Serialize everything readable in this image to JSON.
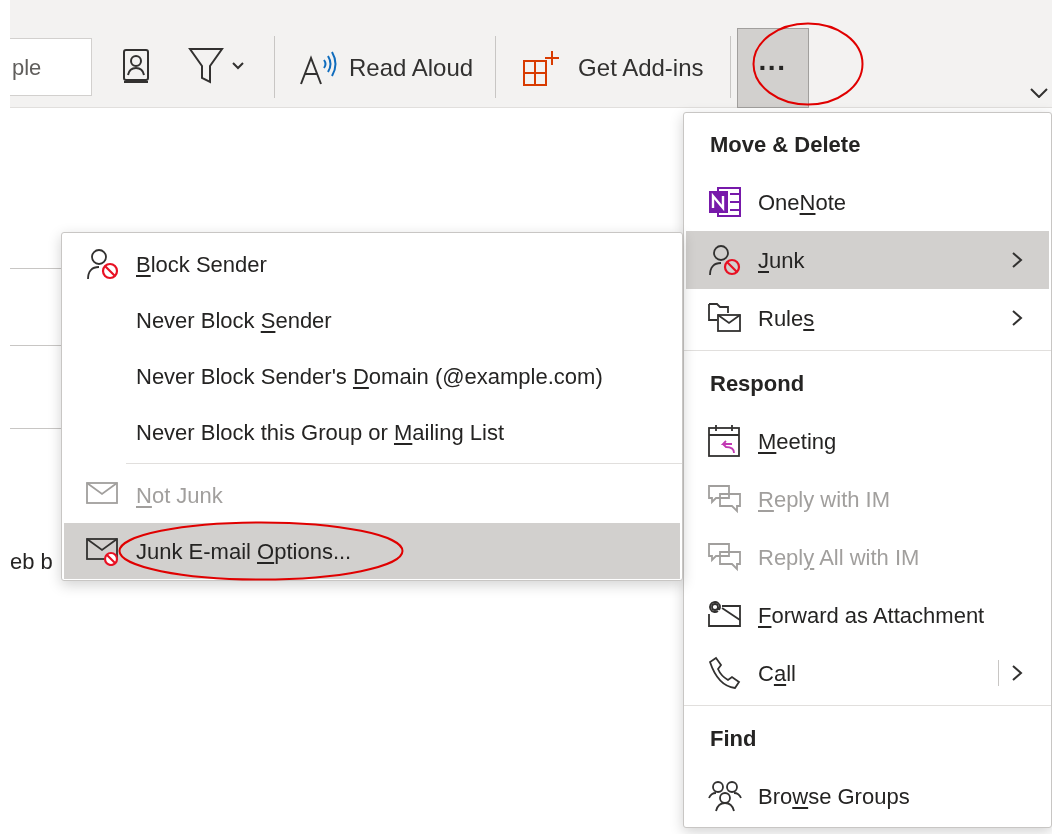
{
  "toolbar": {
    "search_field": {
      "value": "ple"
    },
    "read_aloud": {
      "label": "Read Aloud"
    },
    "get_addins": {
      "label": "Get Add-ins"
    },
    "more_button": {
      "label": "···",
      "selected": true,
      "circled": true
    }
  },
  "background_text": "eb b",
  "more_menu": [
    {
      "kind": "header",
      "label": "Move & Delete"
    },
    {
      "kind": "item",
      "label": {
        "before": "One",
        "key": "N",
        "after": "ote"
      },
      "disabled": false,
      "selected": false,
      "submenu": false,
      "split": false
    },
    {
      "kind": "item",
      "label": {
        "key": "J",
        "after": "unk"
      },
      "disabled": false,
      "selected": true,
      "submenu": true,
      "split": false
    },
    {
      "kind": "item",
      "label": {
        "before": "Rule",
        "key": "s"
      },
      "disabled": false,
      "selected": false,
      "submenu": true,
      "split": false
    },
    {
      "kind": "separator"
    },
    {
      "kind": "header",
      "label": "Respond"
    },
    {
      "kind": "item",
      "label": {
        "key": "M",
        "after": "eeting"
      },
      "disabled": false,
      "selected": false,
      "submenu": false,
      "split": false
    },
    {
      "kind": "item",
      "label": {
        "key": "R",
        "after": "eply with IM"
      },
      "disabled": true,
      "selected": false,
      "submenu": false,
      "split": false
    },
    {
      "kind": "item",
      "label": {
        "before": "Repl",
        "key": "y",
        "after": " All with IM"
      },
      "disabled": true,
      "selected": false,
      "submenu": false,
      "split": false
    },
    {
      "kind": "item",
      "label": {
        "key": "F",
        "after": "orward as Attachment"
      },
      "disabled": false,
      "selected": false,
      "submenu": false,
      "split": false
    },
    {
      "kind": "item",
      "label": {
        "before": "C",
        "key": "a",
        "after": "ll"
      },
      "disabled": false,
      "selected": false,
      "submenu": true,
      "split": true
    },
    {
      "kind": "separator"
    },
    {
      "kind": "header",
      "label": "Find"
    },
    {
      "kind": "item",
      "label": {
        "before": "Bro",
        "key": "w",
        "after": "se Groups"
      },
      "disabled": false,
      "selected": false,
      "submenu": false,
      "split": false
    }
  ],
  "junk_menu": [
    {
      "kind": "item",
      "label": {
        "key": "B",
        "after": "lock Sender"
      },
      "disabled": false,
      "selected": false
    },
    {
      "kind": "item",
      "label": {
        "before": "Never Block ",
        "key": "S",
        "after": "ender"
      },
      "disabled": false,
      "selected": false
    },
    {
      "kind": "item",
      "label": {
        "before": "Never Block Sender's ",
        "key": "D",
        "after": "omain (@example.com)"
      },
      "disabled": false,
      "selected": false
    },
    {
      "kind": "item",
      "label": {
        "before": "Never Block this Group or ",
        "key": "M",
        "after": "ailing List"
      },
      "disabled": false,
      "selected": false
    },
    {
      "kind": "separator"
    },
    {
      "kind": "item",
      "label": {
        "key": "N",
        "after": "ot Junk"
      },
      "disabled": true,
      "selected": false
    },
    {
      "kind": "item",
      "label": {
        "before": "Junk E-mail ",
        "key": "O",
        "after": "ptions..."
      },
      "disabled": false,
      "selected": true,
      "circled": true
    }
  ]
}
